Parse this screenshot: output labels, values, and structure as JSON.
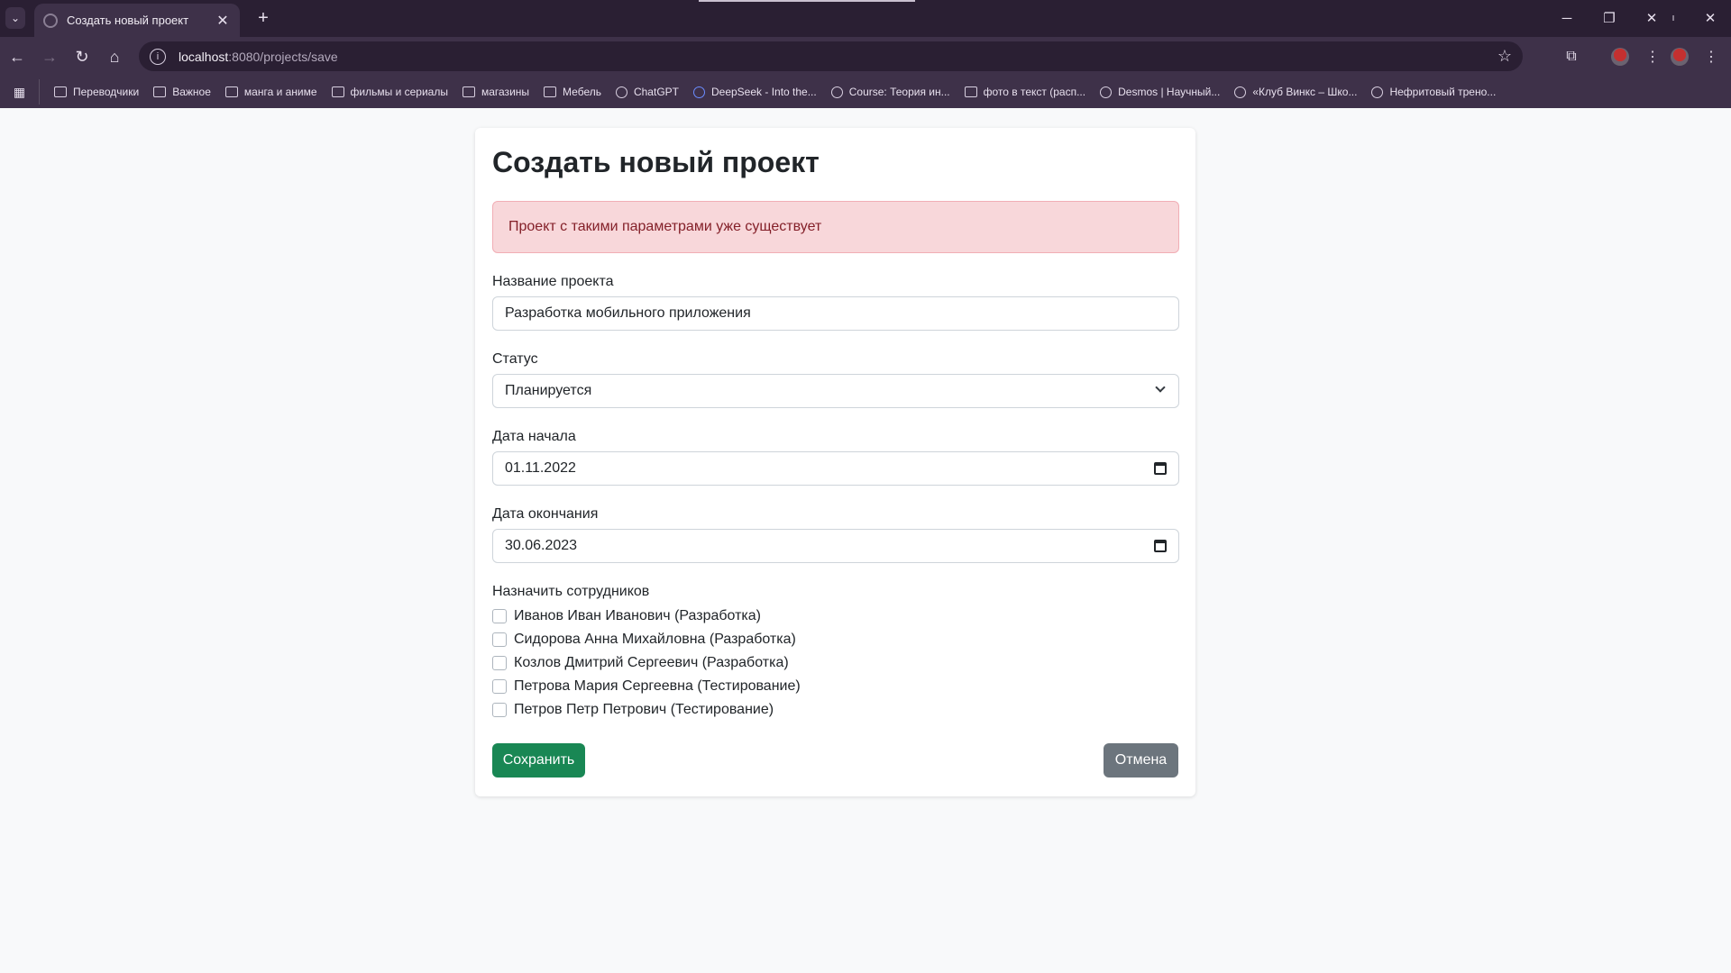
{
  "browser": {
    "tab_title": "Создать новый проект",
    "url_host": "localhost",
    "url_path": ":8080/projects/save",
    "bookmarks": [
      {
        "label": "Переводчики",
        "icon": "folder-icon"
      },
      {
        "label": "Важное",
        "icon": "folder-icon"
      },
      {
        "label": "манга и аниме",
        "icon": "folder-icon"
      },
      {
        "label": "фильмы и сериалы",
        "icon": "folder-icon"
      },
      {
        "label": "магазины",
        "icon": "folder-icon"
      },
      {
        "label": "Мебель",
        "icon": "folder-icon"
      },
      {
        "label": "ChatGPT",
        "icon": "chatgpt-icon"
      },
      {
        "label": "DeepSeek - Into the...",
        "icon": "deepseek-icon"
      },
      {
        "label": "Course: Теория ин...",
        "icon": "course-icon"
      },
      {
        "label": "фото в текст (расп...",
        "icon": "photo-icon"
      },
      {
        "label": "Desmos | Научный...",
        "icon": "globe-icon"
      },
      {
        "label": "«Клуб Винкс – Шко...",
        "icon": "globe-icon"
      },
      {
        "label": "Нефритовый трено...",
        "icon": "globe-icon"
      }
    ]
  },
  "form": {
    "title": "Создать новый проект",
    "alert": "Проект с такими параметрами уже существует",
    "name_label": "Название проекта",
    "name_value": "Разработка мобильного приложения",
    "status_label": "Статус",
    "status_value": "Планируется",
    "start_label": "Дата начала",
    "start_value": "01.11.2022",
    "end_label": "Дата окончания",
    "end_value": "30.06.2023",
    "employees_label": "Назначить сотрудников",
    "employees": [
      {
        "label": "Иванов Иван Иванович (Разработка)",
        "checked": false
      },
      {
        "label": "Сидорова Анна Михайловна (Разработка)",
        "checked": false
      },
      {
        "label": "Козлов Дмитрий Сергеевич (Разработка)",
        "checked": false
      },
      {
        "label": "Петрова Мария Сергеевна (Тестирование)",
        "checked": false
      },
      {
        "label": "Петров Петр Петрович (Тестирование)",
        "checked": false
      }
    ],
    "save_label": "Сохранить",
    "cancel_label": "Отмена"
  },
  "colors": {
    "save_button": "#198754",
    "cancel_button": "#6c757d",
    "alert_bg": "#f8d7da",
    "alert_text": "#842029"
  }
}
